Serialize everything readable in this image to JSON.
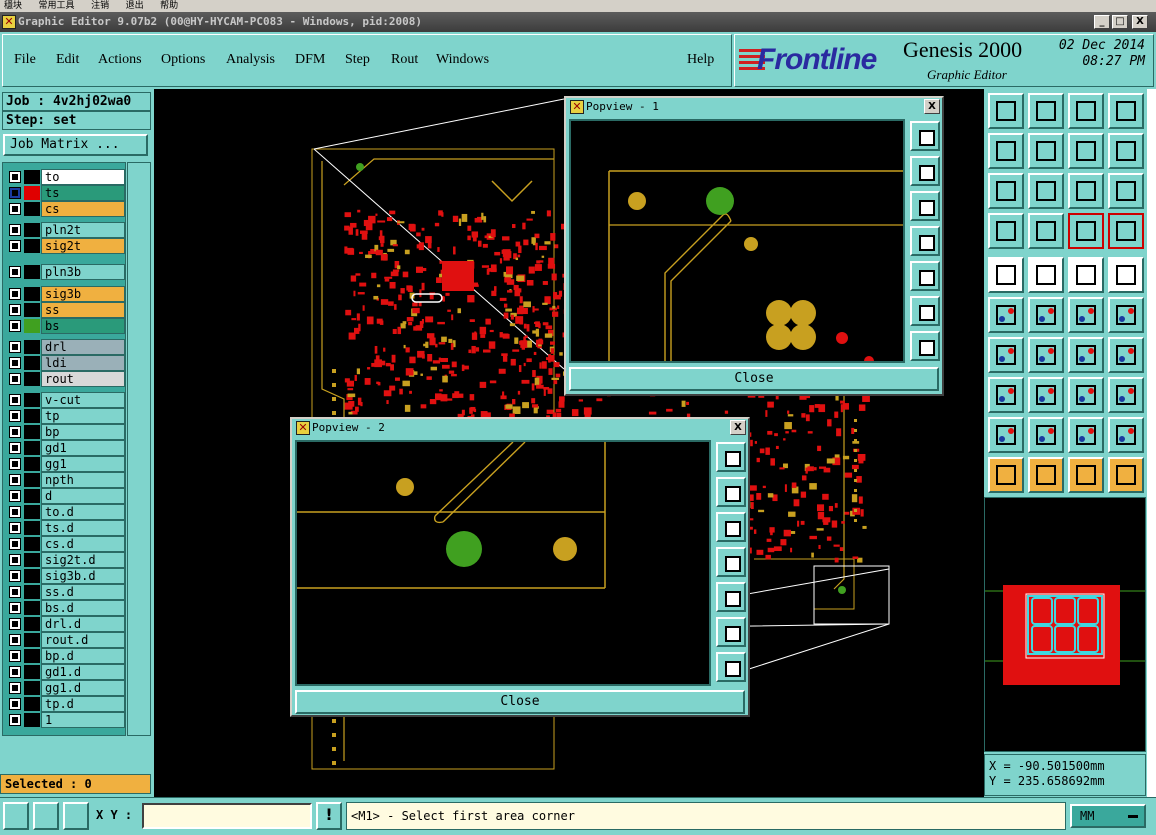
{
  "topstrip": {
    "items": [
      "穩块",
      "常用工具",
      "注销",
      "退出",
      "帮助"
    ]
  },
  "window": {
    "title": "Graphic Editor 9.07b2 (00@HY-HYCAM-PC083 - Windows, pid:2008)",
    "minimize": "_",
    "maximize": "□",
    "close": "X"
  },
  "menu": {
    "items": [
      "File",
      "Edit",
      "Actions",
      "Options",
      "Analysis",
      "DFM",
      "Step",
      "Rout",
      "Windows"
    ],
    "help": "Help"
  },
  "branding": {
    "brand": "Frontline",
    "product": "Genesis 2000",
    "subtitle": "Graphic Editor",
    "date": "02 Dec 2014",
    "time": "08:27 PM"
  },
  "job": {
    "job_label": "Job : 4v2hj02wa0",
    "step_label": "Step: set",
    "job_matrix": "Job Matrix ..."
  },
  "layers": [
    {
      "name": "to",
      "bg": "#ffffff",
      "color": "#000000"
    },
    {
      "name": "ts",
      "bg": "#2a9a7a",
      "color": "#e00000",
      "selected": true
    },
    {
      "name": "cs",
      "bg": "#f0b040",
      "color": "#000000"
    },
    {
      "name": "pln2t",
      "bg": "#7fd4cc",
      "color": "#000000"
    },
    {
      "name": "sig2t",
      "bg": "#f0b040",
      "color": "#000000"
    },
    {
      "name": "pln3b",
      "bg": "#7fd4cc",
      "color": "#000000"
    },
    {
      "name": "sig3b",
      "bg": "#f0b040",
      "color": "#000000"
    },
    {
      "name": "ss",
      "bg": "#f0b040",
      "color": "#000000"
    },
    {
      "name": "bs",
      "bg": "#2a9a7a",
      "color": "#40a020"
    },
    {
      "name": "drl",
      "bg": "#9ab0b8",
      "color": "#000000"
    },
    {
      "name": "ldi",
      "bg": "#9ab0b8",
      "color": "#000000"
    },
    {
      "name": "rout",
      "bg": "#d8d8d8",
      "color": "#000000"
    },
    {
      "name": "v-cut",
      "bg": "#7fd4cc",
      "color": "#000000"
    },
    {
      "name": "tp",
      "bg": "#7fd4cc",
      "color": "#000000"
    },
    {
      "name": "bp",
      "bg": "#7fd4cc",
      "color": "#000000"
    },
    {
      "name": "gd1",
      "bg": "#7fd4cc",
      "color": "#000000"
    },
    {
      "name": "gg1",
      "bg": "#7fd4cc",
      "color": "#000000"
    },
    {
      "name": "npth",
      "bg": "#7fd4cc",
      "color": "#000000"
    },
    {
      "name": "d",
      "bg": "#7fd4cc",
      "color": "#000000"
    },
    {
      "name": "to.d",
      "bg": "#7fd4cc",
      "color": "#000000"
    },
    {
      "name": "ts.d",
      "bg": "#7fd4cc",
      "color": "#000000"
    },
    {
      "name": "cs.d",
      "bg": "#7fd4cc",
      "color": "#000000"
    },
    {
      "name": "sig2t.d",
      "bg": "#7fd4cc",
      "color": "#000000"
    },
    {
      "name": "sig3b.d",
      "bg": "#7fd4cc",
      "color": "#000000"
    },
    {
      "name": "ss.d",
      "bg": "#7fd4cc",
      "color": "#000000"
    },
    {
      "name": "bs.d",
      "bg": "#7fd4cc",
      "color": "#000000"
    },
    {
      "name": "drl.d",
      "bg": "#7fd4cc",
      "color": "#000000"
    },
    {
      "name": "rout.d",
      "bg": "#7fd4cc",
      "color": "#000000"
    },
    {
      "name": "bp.d",
      "bg": "#7fd4cc",
      "color": "#000000"
    },
    {
      "name": "gd1.d",
      "bg": "#7fd4cc",
      "color": "#000000"
    },
    {
      "name": "gg1.d",
      "bg": "#7fd4cc",
      "color": "#000000"
    },
    {
      "name": "tp.d",
      "bg": "#7fd4cc",
      "color": "#000000"
    },
    {
      "name": "1",
      "bg": "#7fd4cc",
      "color": "#000000"
    }
  ],
  "selected_label": "Selected : 0",
  "popview1": {
    "title": "Popview - 1",
    "close": "Close",
    "x": "X"
  },
  "popview2": {
    "title": "Popview - 2",
    "close": "Close",
    "x": "X"
  },
  "coords": {
    "x": "X = -90.501500mm",
    "y": "Y = 235.658692mm"
  },
  "bottom": {
    "xy_label": "X Y :",
    "xy_value": "",
    "alert": "!",
    "message": "<M1> - Select first area corner",
    "unit": "MM"
  },
  "colors": {
    "teal": "#7fd4cc",
    "dark_teal": "#3aa89c",
    "copper": "#c8a020",
    "pad_red": "#e01010",
    "green": "#40a020"
  }
}
